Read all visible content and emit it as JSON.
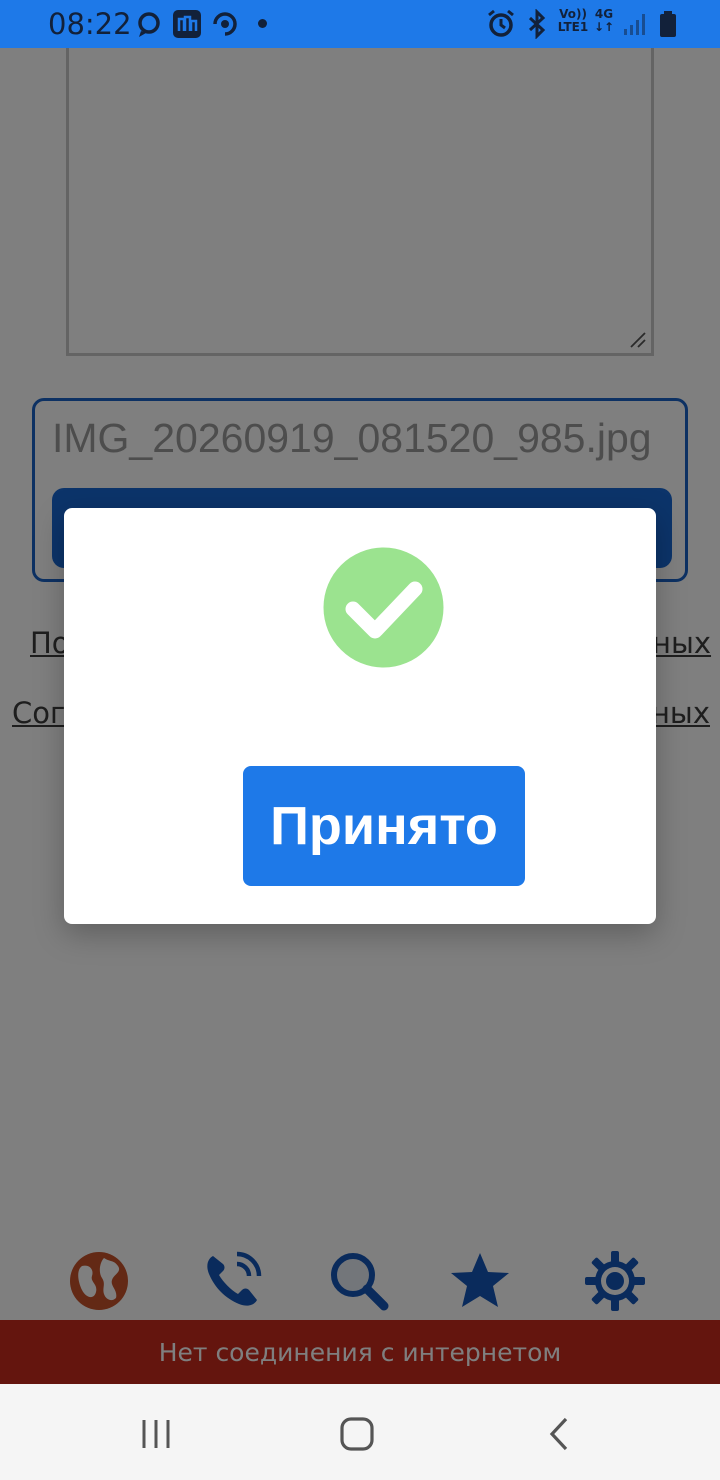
{
  "status_bar": {
    "time": "08:22",
    "left_icons": [
      "chat-bubble-icon",
      "app-square-icon",
      "sync-icon",
      "notification-dot"
    ],
    "right_icons": [
      "alarm-icon",
      "bluetooth-icon",
      "volte-icon",
      "4g-icon",
      "signal-icon",
      "battery-icon"
    ],
    "volte_line1": "Vo))",
    "volte_line2": "LTE1",
    "net_line1": "4G",
    "net_line2": "↓↑"
  },
  "form": {
    "file_name": "IMG_20260919_081520_985.jpg",
    "link_1_visible_left": "По",
    "link_1_visible_right": "ных",
    "link_2_visible_left": "Сог",
    "link_2_visible_right": "нных"
  },
  "dialog": {
    "icon": "success-check-icon",
    "button_label": "Принято"
  },
  "bottom_nav": {
    "items": [
      "globe-icon",
      "phone-call-icon",
      "search-icon",
      "star-icon",
      "gear-icon"
    ]
  },
  "offline_banner": {
    "text": "Нет соединения с интернетом"
  },
  "colors": {
    "accent": "#1e79e8",
    "success": "#9be38f",
    "offline": "#c82a1d"
  }
}
